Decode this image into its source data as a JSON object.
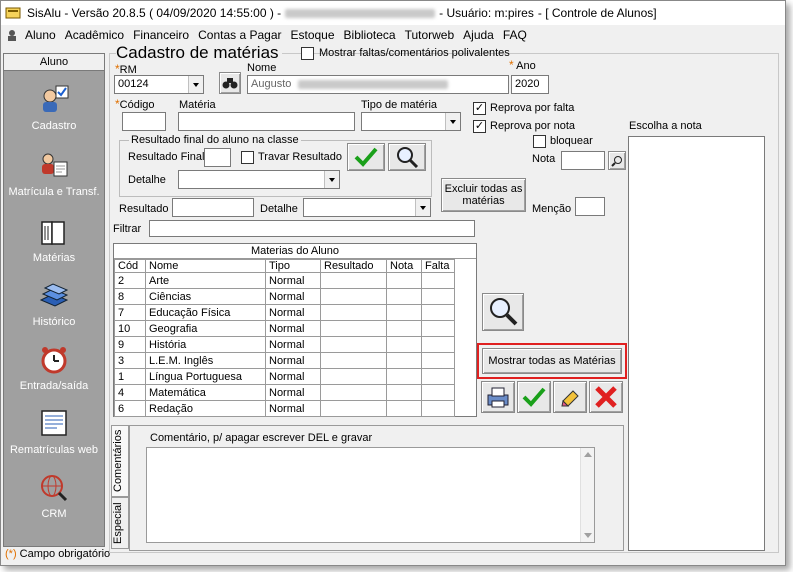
{
  "title": {
    "app": "SisAlu - Versão 20.8.5 ( 04/09/2020 14:55:00 ) -",
    "user": "- Usuário: m:pires",
    "module": "- [ Controle de Alunos]"
  },
  "menu": [
    "Aluno",
    "Acadêmico",
    "Financeiro",
    "Contas a Pagar",
    "Estoque",
    "Biblioteca",
    "Tutorweb",
    "Ajuda",
    "FAQ"
  ],
  "sidebar": {
    "header": "Aluno",
    "items": [
      {
        "label": "Cadastro",
        "icon": "student-check-icon"
      },
      {
        "label": "Matrícula e Transf.",
        "icon": "enrollment-icon"
      },
      {
        "label": "Matérias",
        "icon": "book-icon"
      },
      {
        "label": "Histórico",
        "icon": "books-stack-icon"
      },
      {
        "label": "Entrada/saída",
        "icon": "alarm-clock-icon"
      },
      {
        "label": "Rematrículas web",
        "icon": "web-form-icon"
      },
      {
        "label": "CRM",
        "icon": "crm-globe-icon"
      }
    ]
  },
  "form": {
    "heading": "Cadastro de matérias",
    "show_faults_label": "Mostrar faltas/comentários polivalentes",
    "rm_label": "RM",
    "rm_value": "00124",
    "nome_label": "Nome",
    "nome_value": "Augusto",
    "ano_label": "Ano",
    "ano_value": "2020",
    "codigo_label": "Código",
    "materia_label": "Matéria",
    "tipo_label": "Tipo de matéria",
    "reprova_falta_label": "Reprova por falta",
    "reprova_nota_label": "Reprova por nota",
    "bloquear_label": "bloquear",
    "nota_label": "Nota",
    "group_title": "Resultado final do aluno na classe",
    "resultado_final_label": "Resultado Final",
    "travar_label": "Travar Resultado",
    "detalhe_label": "Detalhe",
    "excluir_label": "Excluir todas as matérias",
    "resultado_label": "Resultado",
    "detalhe2_label": "Detalhe",
    "mencao_label": "Menção",
    "filtrar_label": "Filtrar",
    "escolha_nota_label": "Escolha a nota",
    "mostrar_todas_label": "Mostrar todas as Matérias",
    "comment_label": "Comentário, p/ apagar escrever DEL e gravar",
    "tab_comentarios": "Comentários",
    "tab_especial": "Especial",
    "required_note": "Campo obrigatório",
    "required_mark": "(*)"
  },
  "grid": {
    "title": "Materias do Aluno",
    "columns": [
      "Cód",
      "Nome",
      "Tipo",
      "Resultado",
      "Nota",
      "Falta"
    ],
    "rows": [
      [
        "2",
        "Arte",
        "Normal",
        "",
        "",
        ""
      ],
      [
        "8",
        "Ciências",
        "Normal",
        "",
        "",
        ""
      ],
      [
        "7",
        "Educação Física",
        "Normal",
        "",
        "",
        ""
      ],
      [
        "10",
        "Geografia",
        "Normal",
        "",
        "",
        ""
      ],
      [
        "9",
        "História",
        "Normal",
        "",
        "",
        ""
      ],
      [
        "3",
        "L.E.M. Inglês",
        "Normal",
        "",
        "",
        ""
      ],
      [
        "1",
        "Língua Portuguesa",
        "Normal",
        "",
        "",
        ""
      ],
      [
        "4",
        "Matemática",
        "Normal",
        "",
        "",
        ""
      ],
      [
        "6",
        "Redação",
        "Normal",
        "",
        "",
        ""
      ]
    ]
  },
  "colors": {
    "highlight": "#e02020",
    "required": "#e07000",
    "sidebar": "#a0a0a0"
  }
}
